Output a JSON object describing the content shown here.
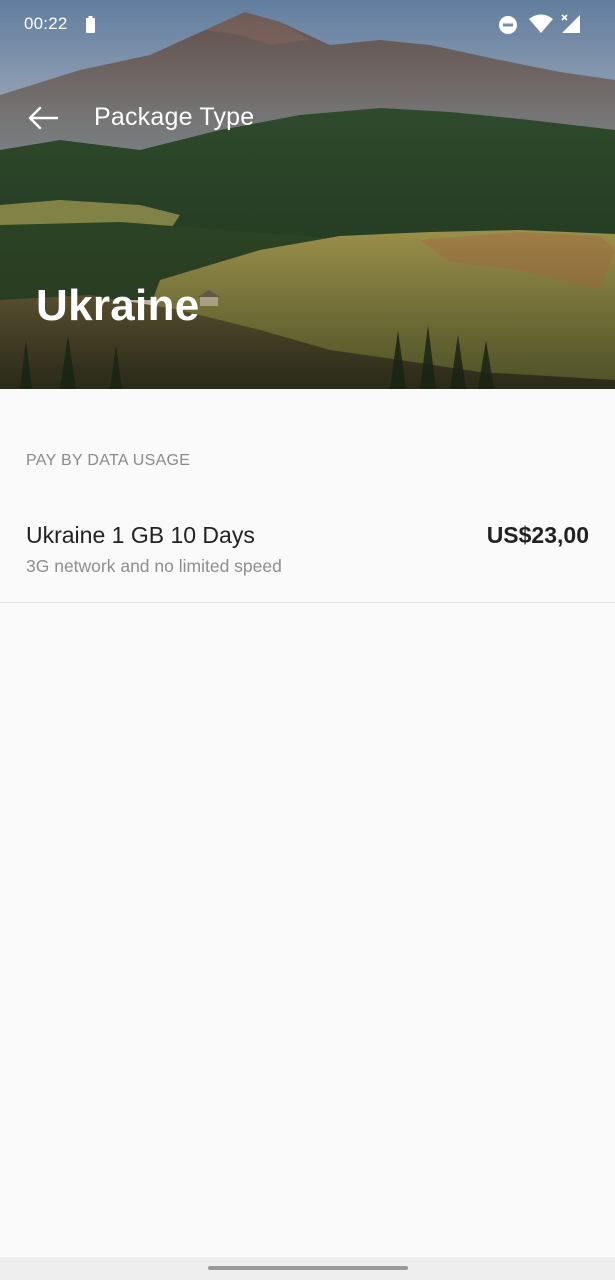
{
  "status_bar": {
    "time": "00:22",
    "icons": [
      "battery-icon",
      "do-not-disturb-icon",
      "wifi-icon",
      "cellular-signal-icon"
    ]
  },
  "toolbar": {
    "title": "Package Type",
    "back_icon": "arrow-back-icon"
  },
  "hero": {
    "country": "Ukraine"
  },
  "section": {
    "header": "PAY BY DATA USAGE",
    "packages": [
      {
        "name": "Ukraine 1 GB 10 Days",
        "description": "3G network and no limited speed",
        "price": "US$23,00"
      }
    ]
  },
  "colors": {
    "title_text": "#ffffff",
    "primary_text": "#222222",
    "secondary_text": "#8e8e8e",
    "background": "#fafafa"
  }
}
